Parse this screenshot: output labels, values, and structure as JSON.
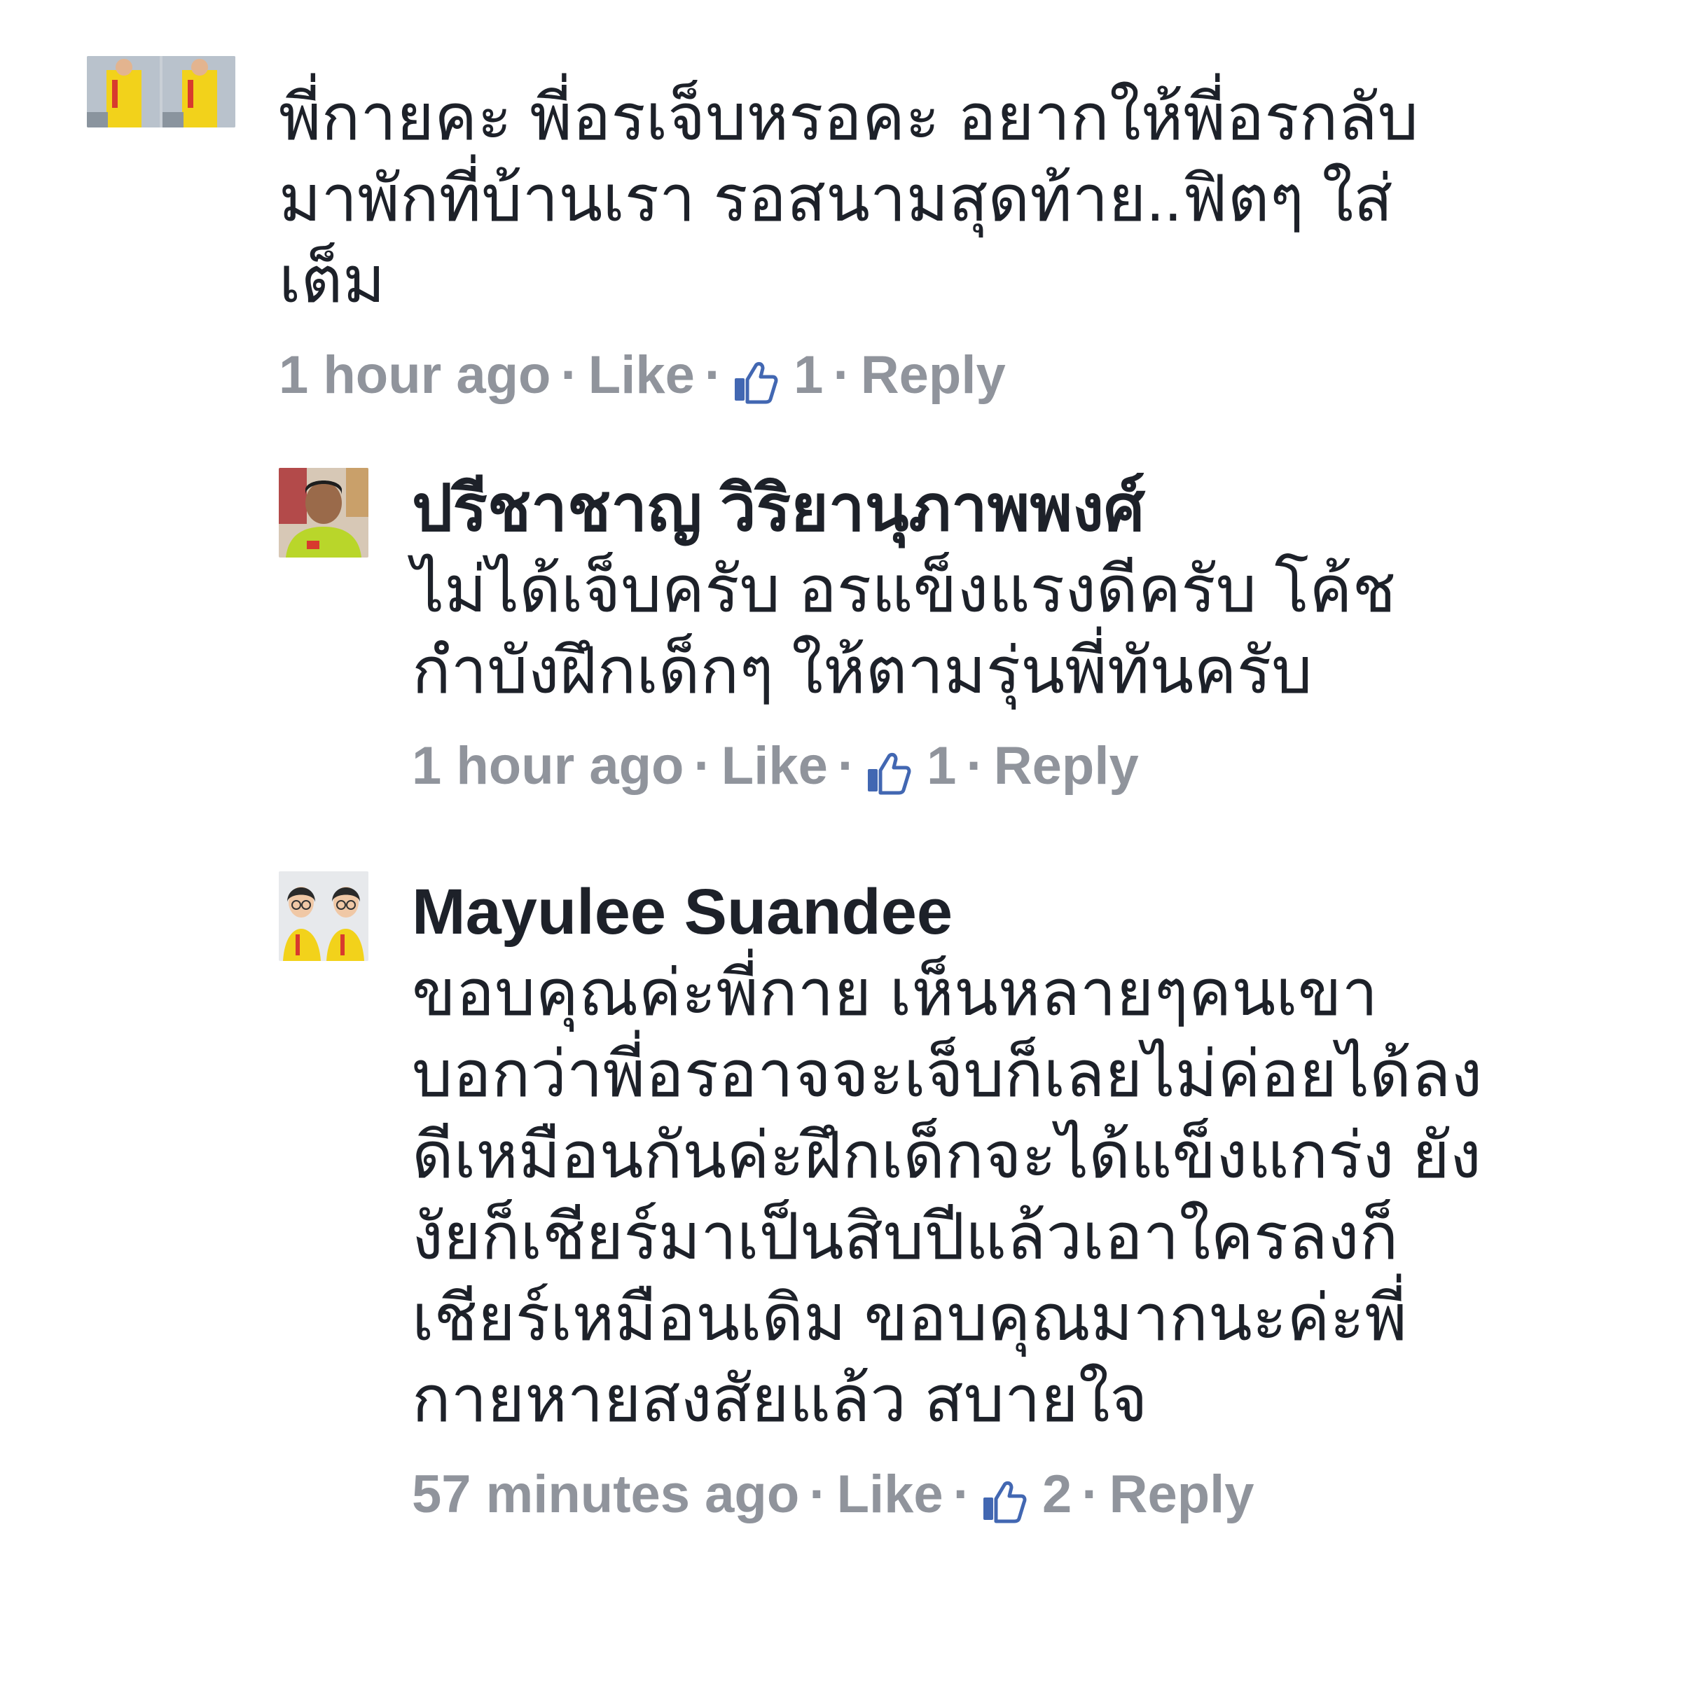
{
  "comments": [
    {
      "author": "",
      "lines": [
        "พี่กายคะ พี่อรเจ็บหรอคะ อยากให้พี่อรกลับ",
        "มาพักที่บ้านเรา รอสนามสุดท้าย..ฟิตๆ ใส่",
        "เต็ม"
      ],
      "time": "1 hour ago",
      "like_label": "Like",
      "like_count": "1",
      "reply_label": "Reply"
    },
    {
      "author": "ปรีชาชาญ วิริยานุภาพพงศ์",
      "lines": [
        "ไม่ได้เจ็บครับ อรแข็งแรงดีครับ โค้ช",
        "กำบังฝึกเด็กๆ ให้ตามรุ่นพี่ทันครับ"
      ],
      "time": "1 hour ago",
      "like_label": "Like",
      "like_count": "1",
      "reply_label": "Reply"
    },
    {
      "author": "Mayulee Suandee",
      "lines": [
        "ขอบคุณค่ะพี่กาย เห็นหลายๆคนเขา",
        "บอกว่าพี่อรอาจจะเจ็บก็เลยไม่ค่อยได้ลง",
        "ดีเหมือนกันค่ะฝึกเด็กจะได้แข็งแกร่ง ยัง",
        "งัยก็เชียร์มาเป็นสิบปีแล้วเอาใครลงก็",
        "เชียร์เหมือนเดิม ขอบคุณมากนะค่ะพี่",
        "กายหายสงสัยแล้ว สบายใจ"
      ],
      "time": "57 minutes ago",
      "like_label": "Like",
      "like_count": "2",
      "reply_label": "Reply"
    }
  ],
  "icons": {
    "like": "thumbs-up-icon"
  },
  "colors": {
    "text": "#1d2129",
    "meta": "#90949c",
    "like_icon": "#4267b2",
    "jersey_yellow": "#f2d21b"
  }
}
